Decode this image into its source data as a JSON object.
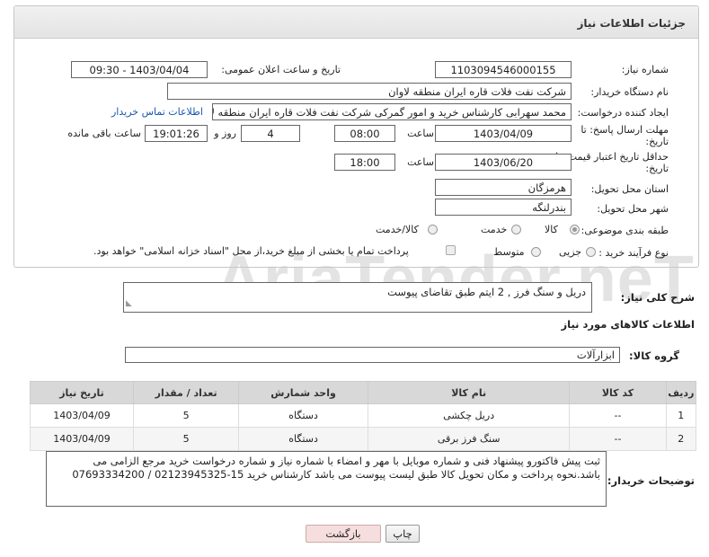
{
  "watermark": "AriaTender.neT",
  "panel": {
    "title": "جزئیات اطلاعات نیاز"
  },
  "fields": {
    "need_number": {
      "label": "شماره نیاز:",
      "value": "1103094546000155"
    },
    "announce": {
      "label": "تاریخ و ساعت اعلان عمومی:",
      "value": "1403/04/04 - 09:30"
    },
    "buyer_org": {
      "label": "نام دستگاه خریدار:",
      "value": "شرکت نفت فلات قاره ایران منطقه لاوان"
    },
    "requester": {
      "label": "ایجاد کننده درخواست:",
      "value": "محمد سهرابی کارشناس خرید و امور گمرکی شرکت نفت فلات قاره ایران منطقه لاوان",
      "contact_link": "اطلاعات تماس خریدار"
    },
    "deadline": {
      "label_line1": "مهلت ارسال پاسخ: تا",
      "label_line2": "تاریخ:",
      "date": "1403/04/09",
      "time_label": "ساعت",
      "time": "08:00",
      "days": "4",
      "days_label": "روز و",
      "remaining": "19:01:26",
      "remaining_label": "ساعت باقی مانده"
    },
    "validity": {
      "label_line1": "حداقل تاریخ اعتبار قیمت: تا",
      "label_line2": "تاریخ:",
      "date": "1403/06/20",
      "time_label": "ساعت",
      "time": "18:00"
    },
    "province": {
      "label": "استان محل تحویل:",
      "value": "هرمزگان"
    },
    "city": {
      "label": "شهر محل تحویل:",
      "value": "بندرلنگه"
    },
    "category": {
      "label": "طبقه بندی موضوعی:",
      "options": [
        "کالا",
        "خدمت",
        "کالا/خدمت"
      ],
      "selected": "کالا"
    },
    "process": {
      "label": "نوع فرآیند خرید :",
      "options": [
        "جزیی",
        "متوسط"
      ],
      "selected": "جزیی",
      "payment_note": "پرداخت تمام یا بخشی از مبلغ خرید،از محل \"اسناد خزانه اسلامی\" خواهد بود."
    }
  },
  "summary": {
    "label": "شرح کلی نیاز:",
    "value": "دریل و سنگ فرز , 2 ایتم طبق تقاضای پیوست"
  },
  "goods_section": {
    "title": "اطلاعات کالاهای مورد نیاز"
  },
  "goods_group": {
    "label": "گروه کالا:",
    "value": "ابزارآلات"
  },
  "table": {
    "headers": [
      "ردیف",
      "کد کالا",
      "نام کالا",
      "واحد شمارش",
      "تعداد / مقدار",
      "تاریخ نیاز"
    ],
    "rows": [
      [
        "1",
        "--",
        "دریل چکشی",
        "دستگاه",
        "5",
        "1403/04/09"
      ],
      [
        "2",
        "--",
        "سنگ فرز برقی",
        "دستگاه",
        "5",
        "1403/04/09"
      ]
    ]
  },
  "buyer_notes": {
    "label": "توضیحات خریدار:",
    "value": "ثبت پیش فاکتورو پیشنهاد فنی و شماره موبایل با مهر و امضاء با شماره نیاز و شماره درخواست خرید مرجع الزامی می باشد.نحوه پرداخت و مکان تحویل کالا طبق لیست پیوست می باشد کارشناس خرید 15-02123945325 / 07693334200"
  },
  "buttons": {
    "print": "چاپ",
    "back": "بازگشت"
  }
}
